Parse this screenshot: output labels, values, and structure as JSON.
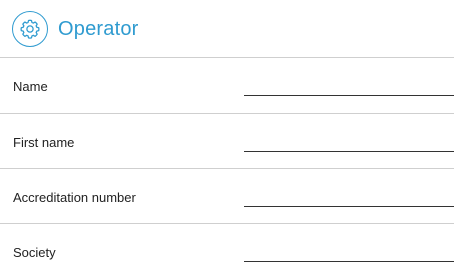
{
  "header": {
    "title": "Operator",
    "icon": "gear-icon",
    "accent_color": "#2f9bd0"
  },
  "fields": [
    {
      "label": "Name",
      "value": ""
    },
    {
      "label": "First name",
      "value": ""
    },
    {
      "label": "Accreditation number",
      "value": ""
    },
    {
      "label": "Society",
      "value": ""
    }
  ]
}
